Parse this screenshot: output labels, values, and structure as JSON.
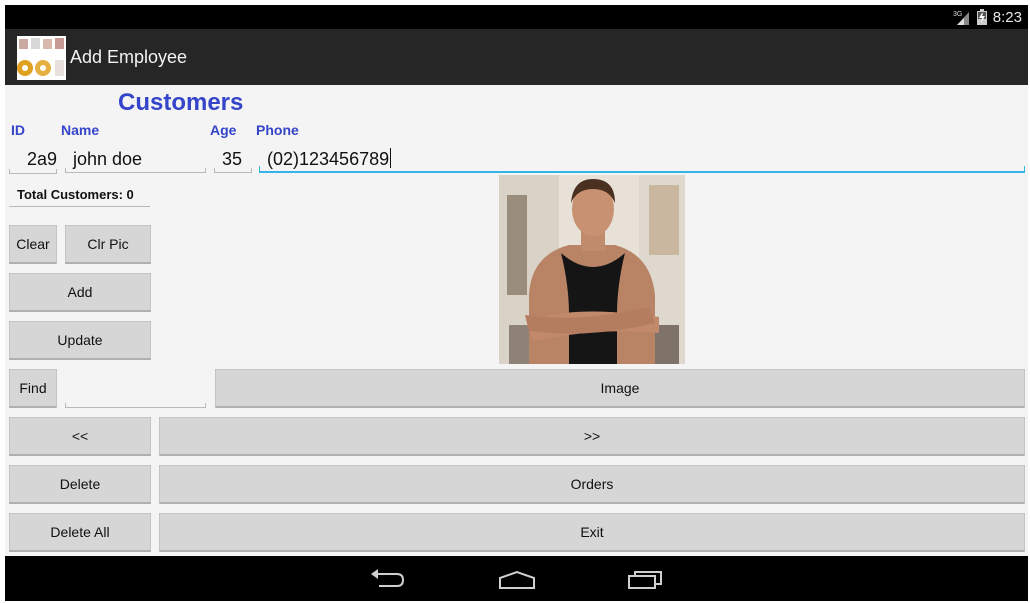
{
  "status_bar": {
    "network": "3G",
    "clock": "8:23"
  },
  "action_bar": {
    "title": "Add Employee",
    "app_icon": "cups-and-donuts-icon"
  },
  "form": {
    "heading": "Customers",
    "labels": {
      "id": "ID",
      "name": "Name",
      "age": "Age",
      "phone": "Phone"
    },
    "values": {
      "id": "2a9",
      "name": "john doe",
      "age": "35",
      "phone": "(02)123456789"
    },
    "total": "Total Customers: 0",
    "find_value": ""
  },
  "buttons": {
    "clear": "Clear",
    "clr_pic": "Clr Pic",
    "add": "Add",
    "update": "Update",
    "find": "Find",
    "image": "Image",
    "prev": "<<",
    "next": ">>",
    "delete": "Delete",
    "orders": "Orders",
    "delete_all": "Delete All",
    "exit": "Exit"
  },
  "nav_bar": {
    "icons": [
      "back-icon",
      "home-icon",
      "recent-apps-icon"
    ]
  },
  "colors": {
    "accent": "#3545c9",
    "focus": "#33b5e5",
    "action_bar": "#262626",
    "button": "#d6d6d6"
  }
}
